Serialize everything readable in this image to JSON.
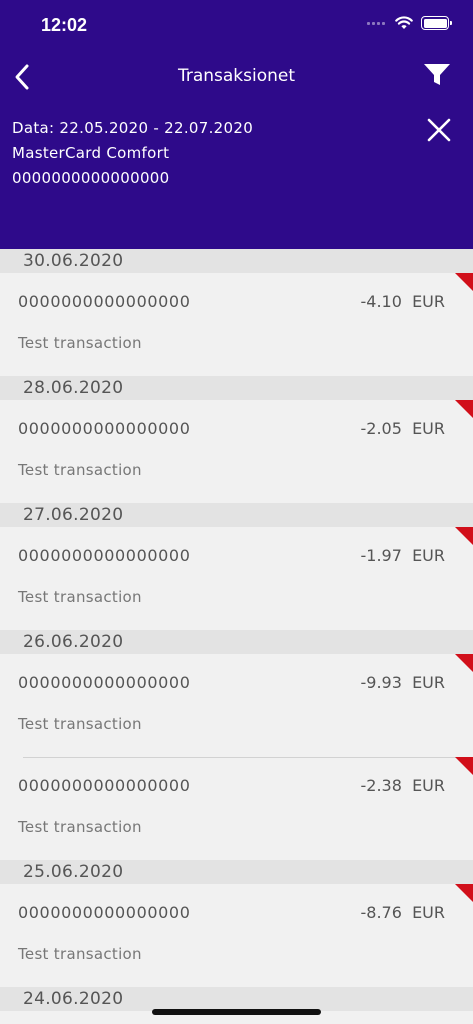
{
  "status_bar": {
    "time": "12:02"
  },
  "header": {
    "title": "Transaksionet",
    "filter_date": "Data: 22.05.2020 - 22.07.2020",
    "card_name": "MasterCard Comfort",
    "card_number": "0000000000000000"
  },
  "colors": {
    "header_bg": "#2e0a8a",
    "flag": "#d10f1a"
  },
  "icons": {
    "back": "chevron-left-icon",
    "filter": "funnel-icon",
    "close": "close-icon"
  },
  "groups": [
    {
      "date": "30.06.2020",
      "items": [
        {
          "card": "0000000000000000",
          "amount": "-4.10",
          "currency": "EUR",
          "description": "Test transaction"
        }
      ]
    },
    {
      "date": "28.06.2020",
      "items": [
        {
          "card": "0000000000000000",
          "amount": "-2.05",
          "currency": "EUR",
          "description": "Test transaction"
        }
      ]
    },
    {
      "date": "27.06.2020",
      "items": [
        {
          "card": "0000000000000000",
          "amount": "-1.97",
          "currency": "EUR",
          "description": "Test transaction"
        }
      ]
    },
    {
      "date": "26.06.2020",
      "items": [
        {
          "card": "0000000000000000",
          "amount": "-9.93",
          "currency": "EUR",
          "description": "Test transaction"
        },
        {
          "card": "0000000000000000",
          "amount": "-2.38",
          "currency": "EUR",
          "description": "Test transaction"
        }
      ]
    },
    {
      "date": "25.06.2020",
      "items": [
        {
          "card": "0000000000000000",
          "amount": "-8.76",
          "currency": "EUR",
          "description": "Test transaction"
        }
      ]
    },
    {
      "date": "24.06.2020",
      "items": []
    }
  ]
}
